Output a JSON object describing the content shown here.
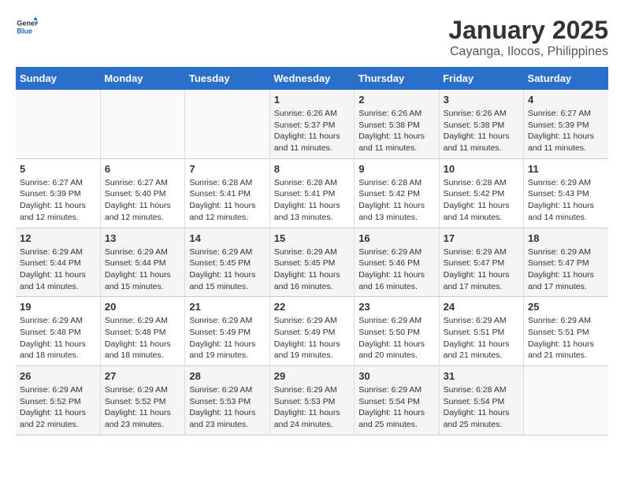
{
  "header": {
    "logo_line1": "General",
    "logo_line2": "Blue",
    "month": "January 2025",
    "location": "Cayanga, Ilocos, Philippines"
  },
  "weekdays": [
    "Sunday",
    "Monday",
    "Tuesday",
    "Wednesday",
    "Thursday",
    "Friday",
    "Saturday"
  ],
  "weeks": [
    [
      {
        "day": "",
        "info": ""
      },
      {
        "day": "",
        "info": ""
      },
      {
        "day": "",
        "info": ""
      },
      {
        "day": "1",
        "info": "Sunrise: 6:26 AM\nSunset: 5:37 PM\nDaylight: 11 hours and 11 minutes."
      },
      {
        "day": "2",
        "info": "Sunrise: 6:26 AM\nSunset: 5:38 PM\nDaylight: 11 hours and 11 minutes."
      },
      {
        "day": "3",
        "info": "Sunrise: 6:26 AM\nSunset: 5:38 PM\nDaylight: 11 hours and 11 minutes."
      },
      {
        "day": "4",
        "info": "Sunrise: 6:27 AM\nSunset: 5:39 PM\nDaylight: 11 hours and 11 minutes."
      }
    ],
    [
      {
        "day": "5",
        "info": "Sunrise: 6:27 AM\nSunset: 5:39 PM\nDaylight: 11 hours and 12 minutes."
      },
      {
        "day": "6",
        "info": "Sunrise: 6:27 AM\nSunset: 5:40 PM\nDaylight: 11 hours and 12 minutes."
      },
      {
        "day": "7",
        "info": "Sunrise: 6:28 AM\nSunset: 5:41 PM\nDaylight: 11 hours and 12 minutes."
      },
      {
        "day": "8",
        "info": "Sunrise: 6:28 AM\nSunset: 5:41 PM\nDaylight: 11 hours and 13 minutes."
      },
      {
        "day": "9",
        "info": "Sunrise: 6:28 AM\nSunset: 5:42 PM\nDaylight: 11 hours and 13 minutes."
      },
      {
        "day": "10",
        "info": "Sunrise: 6:28 AM\nSunset: 5:42 PM\nDaylight: 11 hours and 14 minutes."
      },
      {
        "day": "11",
        "info": "Sunrise: 6:29 AM\nSunset: 5:43 PM\nDaylight: 11 hours and 14 minutes."
      }
    ],
    [
      {
        "day": "12",
        "info": "Sunrise: 6:29 AM\nSunset: 5:44 PM\nDaylight: 11 hours and 14 minutes."
      },
      {
        "day": "13",
        "info": "Sunrise: 6:29 AM\nSunset: 5:44 PM\nDaylight: 11 hours and 15 minutes."
      },
      {
        "day": "14",
        "info": "Sunrise: 6:29 AM\nSunset: 5:45 PM\nDaylight: 11 hours and 15 minutes."
      },
      {
        "day": "15",
        "info": "Sunrise: 6:29 AM\nSunset: 5:45 PM\nDaylight: 11 hours and 16 minutes."
      },
      {
        "day": "16",
        "info": "Sunrise: 6:29 AM\nSunset: 5:46 PM\nDaylight: 11 hours and 16 minutes."
      },
      {
        "day": "17",
        "info": "Sunrise: 6:29 AM\nSunset: 5:47 PM\nDaylight: 11 hours and 17 minutes."
      },
      {
        "day": "18",
        "info": "Sunrise: 6:29 AM\nSunset: 5:47 PM\nDaylight: 11 hours and 17 minutes."
      }
    ],
    [
      {
        "day": "19",
        "info": "Sunrise: 6:29 AM\nSunset: 5:48 PM\nDaylight: 11 hours and 18 minutes."
      },
      {
        "day": "20",
        "info": "Sunrise: 6:29 AM\nSunset: 5:48 PM\nDaylight: 11 hours and 18 minutes."
      },
      {
        "day": "21",
        "info": "Sunrise: 6:29 AM\nSunset: 5:49 PM\nDaylight: 11 hours and 19 minutes."
      },
      {
        "day": "22",
        "info": "Sunrise: 6:29 AM\nSunset: 5:49 PM\nDaylight: 11 hours and 19 minutes."
      },
      {
        "day": "23",
        "info": "Sunrise: 6:29 AM\nSunset: 5:50 PM\nDaylight: 11 hours and 20 minutes."
      },
      {
        "day": "24",
        "info": "Sunrise: 6:29 AM\nSunset: 5:51 PM\nDaylight: 11 hours and 21 minutes."
      },
      {
        "day": "25",
        "info": "Sunrise: 6:29 AM\nSunset: 5:51 PM\nDaylight: 11 hours and 21 minutes."
      }
    ],
    [
      {
        "day": "26",
        "info": "Sunrise: 6:29 AM\nSunset: 5:52 PM\nDaylight: 11 hours and 22 minutes."
      },
      {
        "day": "27",
        "info": "Sunrise: 6:29 AM\nSunset: 5:52 PM\nDaylight: 11 hours and 23 minutes."
      },
      {
        "day": "28",
        "info": "Sunrise: 6:29 AM\nSunset: 5:53 PM\nDaylight: 11 hours and 23 minutes."
      },
      {
        "day": "29",
        "info": "Sunrise: 6:29 AM\nSunset: 5:53 PM\nDaylight: 11 hours and 24 minutes."
      },
      {
        "day": "30",
        "info": "Sunrise: 6:29 AM\nSunset: 5:54 PM\nDaylight: 11 hours and 25 minutes."
      },
      {
        "day": "31",
        "info": "Sunrise: 6:28 AM\nSunset: 5:54 PM\nDaylight: 11 hours and 25 minutes."
      },
      {
        "day": "",
        "info": ""
      }
    ]
  ]
}
